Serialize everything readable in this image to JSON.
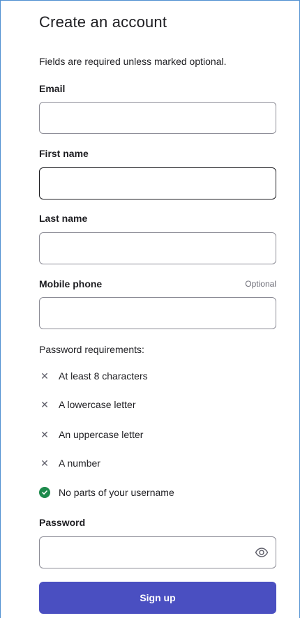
{
  "form": {
    "title": "Create an account",
    "subtitle": "Fields are required unless marked optional.",
    "fields": {
      "email": {
        "label": "Email",
        "value": "",
        "placeholder": ""
      },
      "first_name": {
        "label": "First name",
        "value": "",
        "placeholder": ""
      },
      "last_name": {
        "label": "Last name",
        "value": "",
        "placeholder": ""
      },
      "mobile_phone": {
        "label": "Mobile phone",
        "optional_label": "Optional",
        "value": "",
        "placeholder": ""
      },
      "password": {
        "label": "Password",
        "value": "",
        "placeholder": ""
      }
    },
    "password_requirements": {
      "heading": "Password requirements:",
      "items": [
        {
          "text": "At least 8 characters",
          "met": false,
          "icon": "x-icon"
        },
        {
          "text": "A lowercase letter",
          "met": false,
          "icon": "x-icon"
        },
        {
          "text": "An uppercase letter",
          "met": false,
          "icon": "x-icon"
        },
        {
          "text": "A number",
          "met": false,
          "icon": "x-icon"
        },
        {
          "text": "No parts of your username",
          "met": true,
          "icon": "check-circle-icon"
        }
      ]
    },
    "submit_label": "Sign up"
  },
  "colors": {
    "accent": "#4a4fc1",
    "success": "#1d8a4c",
    "frame_border": "#4f8fd1"
  }
}
